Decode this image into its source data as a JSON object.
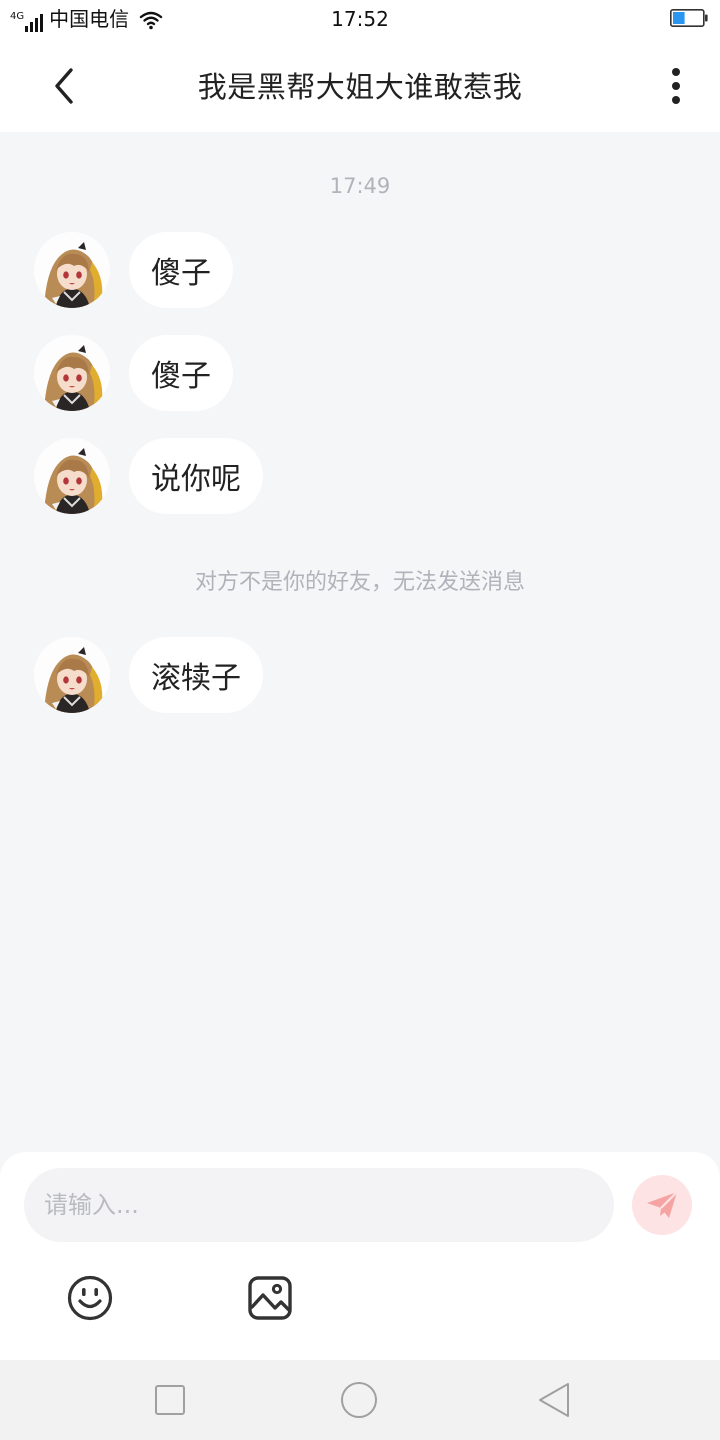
{
  "status_bar": {
    "network": "4G",
    "carrier": "中国电信",
    "time": "17:52",
    "battery_level": 0.4
  },
  "header": {
    "title": "我是黑帮大姐大谁敢惹我"
  },
  "chat": {
    "timestamp": "17:49",
    "messages": [
      {
        "text": "傻子"
      },
      {
        "text": "傻子"
      },
      {
        "text": "说你呢"
      },
      {
        "text": "滚犊子"
      }
    ],
    "system_note": "对方不是你的好友，无法发送消息"
  },
  "input": {
    "placeholder": "请输入..."
  },
  "colors": {
    "page_background": "#f5f6f8",
    "bubble_background": "#ffffff",
    "muted_text": "#b0b3ba",
    "send_button_bg": "#fde3e3",
    "send_icon": "#f6a3a3"
  },
  "icons": {
    "back": "chevron-left-icon",
    "more": "more-vertical-icon",
    "send": "paper-plane-icon",
    "emoji": "smiley-icon",
    "image": "image-icon",
    "nav_recents": "square-icon",
    "nav_home": "circle-icon",
    "nav_back": "triangle-back-icon"
  }
}
